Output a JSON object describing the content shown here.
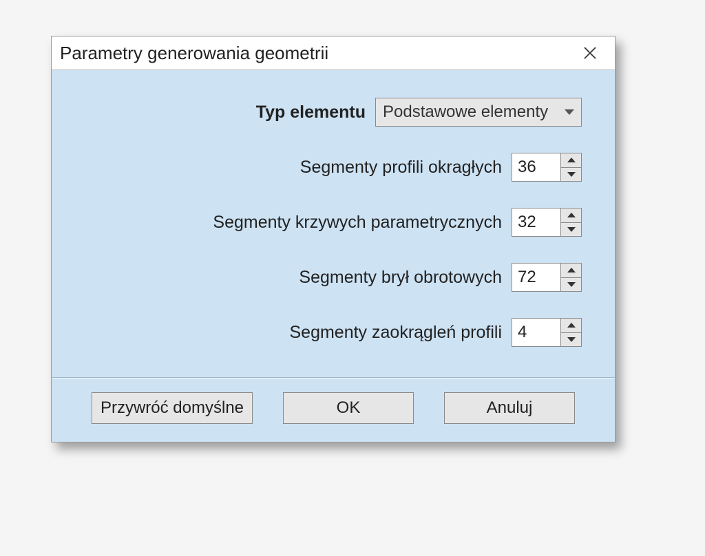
{
  "dialog": {
    "title": "Parametry generowania geometrii"
  },
  "form": {
    "element_type_label": "Typ elementu",
    "element_type_value": "Podstawowe elementy",
    "fields": [
      {
        "label": "Segmenty profili okragłych",
        "value": "36"
      },
      {
        "label": "Segmenty krzywych parametrycznych",
        "value": "32"
      },
      {
        "label": "Segmenty brył obrotowych",
        "value": "72"
      },
      {
        "label": "Segmenty zaokrągleń profili",
        "value": "4"
      }
    ]
  },
  "buttons": {
    "restore": "Przywróć domyślne",
    "ok": "OK",
    "cancel": "Anuluj"
  }
}
